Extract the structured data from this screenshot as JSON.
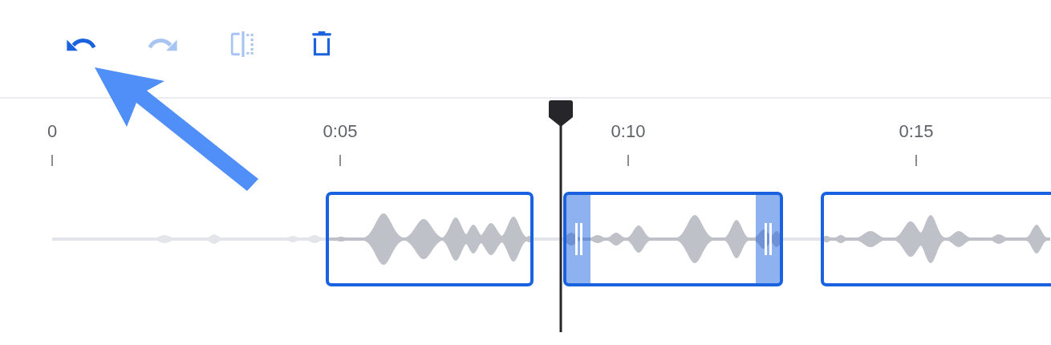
{
  "toolbar": [
    {
      "kind": "undo",
      "disabled": false
    },
    {
      "kind": "redo",
      "disabled": true
    },
    {
      "kind": "split",
      "disabled": true
    },
    {
      "kind": "delete",
      "disabled": false
    }
  ],
  "ruler": {
    "labels": [
      "0",
      "0:05",
      "0:10",
      "0:15"
    ]
  },
  "clips": [
    {
      "selected": false
    },
    {
      "selected": true
    },
    {
      "selected": false
    }
  ]
}
